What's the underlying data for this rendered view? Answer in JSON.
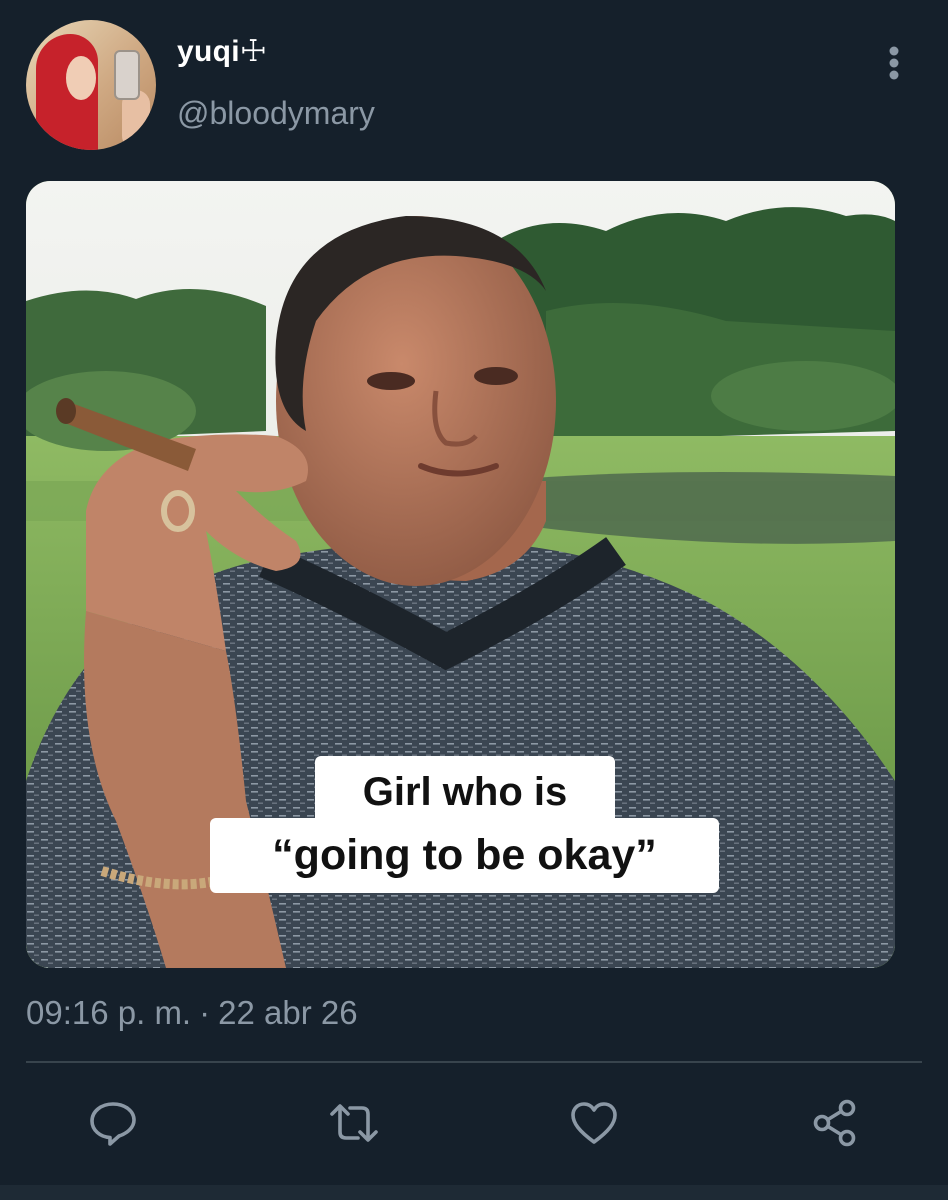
{
  "author": {
    "display_name": "yuqi☩",
    "handle": "@bloodymary"
  },
  "media": {
    "caption_line1": "Girl who is",
    "caption_line2": "“going to be okay”"
  },
  "meta": {
    "time": "09:16 p. m.",
    "separator": "·",
    "date": "22 abr 26"
  },
  "actions": {
    "reply_icon": "reply-icon",
    "retweet_icon": "retweet-icon",
    "like_icon": "heart-icon",
    "share_icon": "share-icon"
  },
  "colors": {
    "background": "#15202b",
    "secondary_text": "#8b98a5",
    "divider": "#38444d"
  }
}
